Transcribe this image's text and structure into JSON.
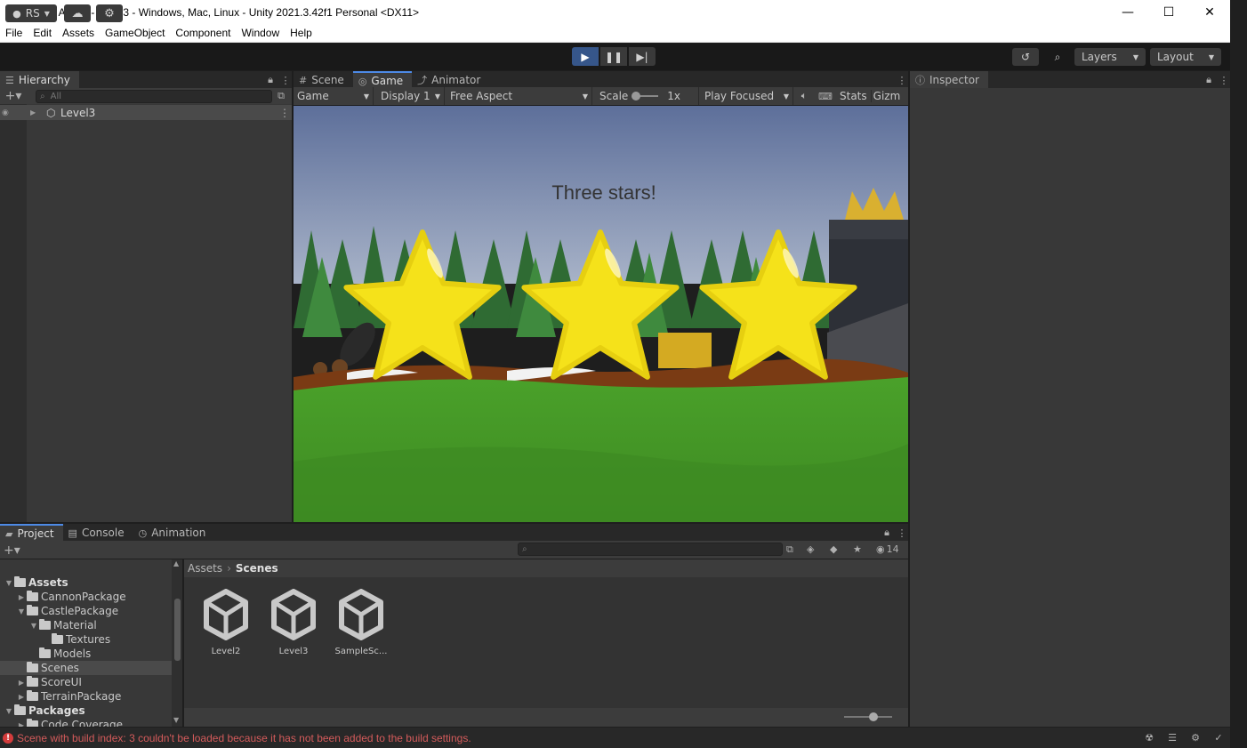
{
  "window": {
    "title": "Castle Attack - Level3 - Windows, Mac, Linux - Unity 2021.3.42f1 Personal <DX11>",
    "controls": [
      "—",
      "☐",
      "✕"
    ]
  },
  "menu": [
    "File",
    "Edit",
    "Assets",
    "GameObject",
    "Component",
    "Window",
    "Help"
  ],
  "toolbar": {
    "account": "RS",
    "layers": "Layers",
    "layout": "Layout"
  },
  "hierarchy": {
    "tab": "Hierarchy",
    "search_placeholder": "All",
    "scene": "Level3"
  },
  "center_tabs": [
    "Scene",
    "Game",
    "Animator"
  ],
  "game_controls": {
    "mode": "Game",
    "display": "Display 1",
    "aspect": "Free Aspect",
    "scale_label": "Scale",
    "scale_value": "1x",
    "play_mode": "Play Focused",
    "stats": "Stats",
    "gizmos": "Gizm"
  },
  "game_view": {
    "message": "Three stars!",
    "stars_earned": 3,
    "stars_total": 3
  },
  "inspector": {
    "tab": "Inspector"
  },
  "bottom_tabs": [
    "Project",
    "Console",
    "Animation"
  ],
  "project": {
    "hidden_count": "14",
    "breadcrumb": [
      "Assets",
      "Scenes"
    ],
    "tree": [
      {
        "label": "Assets",
        "level": 0,
        "expanded": true,
        "bold": true
      },
      {
        "label": "CannonPackage",
        "level": 1,
        "expanded": false
      },
      {
        "label": "CastlePackage",
        "level": 1,
        "expanded": true
      },
      {
        "label": "Material",
        "level": 2,
        "expanded": true
      },
      {
        "label": "Textures",
        "level": 3,
        "leaf": true
      },
      {
        "label": "Models",
        "level": 2,
        "leaf": true
      },
      {
        "label": "Scenes",
        "level": 1,
        "leaf": true,
        "selected": true
      },
      {
        "label": "ScoreUI",
        "level": 1,
        "expanded": false
      },
      {
        "label": "TerrainPackage",
        "level": 1,
        "expanded": false
      },
      {
        "label": "Packages",
        "level": 0,
        "expanded": true,
        "bold": true
      },
      {
        "label": "Code Coverage",
        "level": 1,
        "expanded": false
      }
    ],
    "assets": [
      "Level2",
      "Level3",
      "SampleSc..."
    ]
  },
  "status": {
    "error": "Scene with build index: 3 couldn't be loaded because it has not been added to the build settings."
  },
  "colors": {
    "accent": "#4d8ae6",
    "play_active": "#36568a",
    "error": "#d45b5b",
    "star": "#f5e21a"
  }
}
